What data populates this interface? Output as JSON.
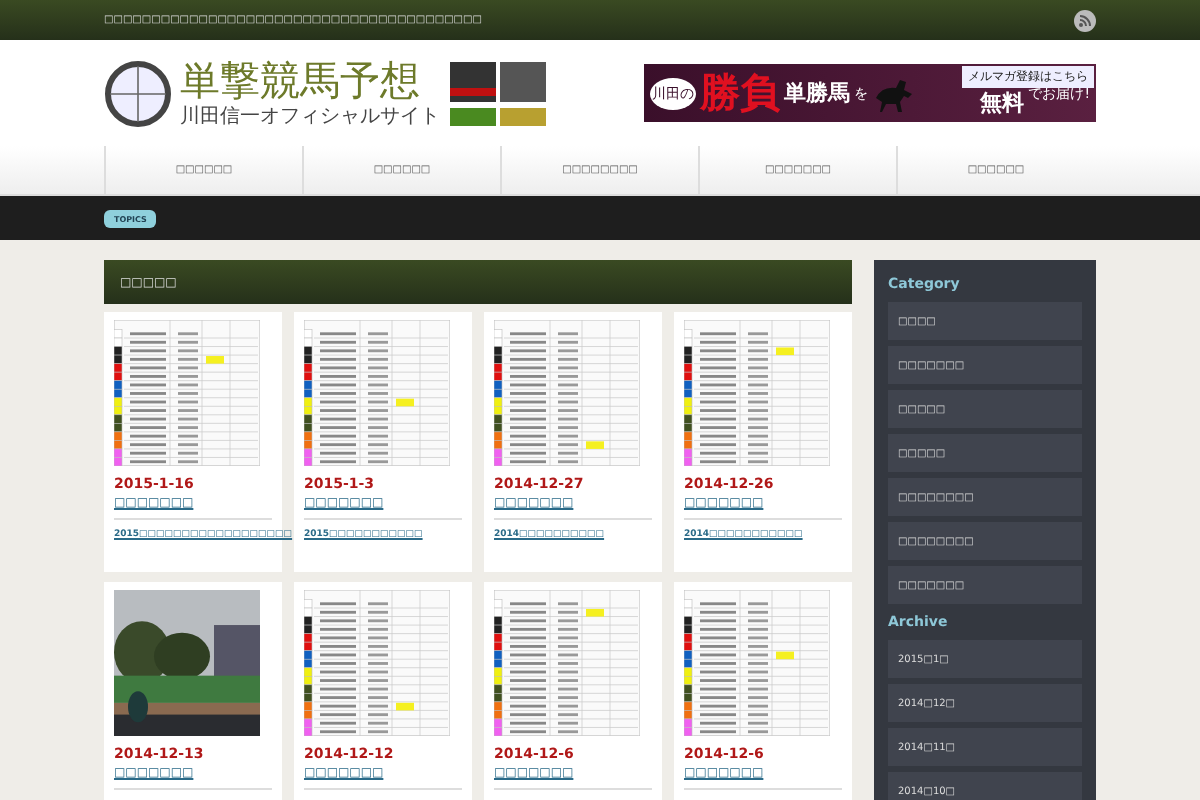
{
  "top_bar": {
    "text": "□□□□□□□□□□□□□□□□□□□□□□□□□□□□□□□□□□□□□□□□"
  },
  "logo": {
    "title": "単撃競馬予想",
    "subtitle": "川田信一オフィシャルサイト"
  },
  "banner": {
    "prefix": "川田の",
    "big": "勝負",
    "horse": "単勝馬",
    "particle": "を",
    "signup": "メルマガ登録はこちら",
    "free": "無料",
    "suffix": "でお届け!"
  },
  "nav": [
    {
      "label": "□□□□□□"
    },
    {
      "label": "□□□□□□"
    },
    {
      "label": "□□□□□□□□"
    },
    {
      "label": "□□□□□□□"
    },
    {
      "label": "□□□□□□"
    }
  ],
  "topics": {
    "badge": "TOPICS"
  },
  "section": {
    "title": "□□□□□"
  },
  "cards": [
    {
      "kind": "table",
      "date": "2015-1-16",
      "category": "□□□□□□□",
      "title": "2015□□□□□□□□□□□□□□□□□□"
    },
    {
      "kind": "table",
      "date": "2015-1-3",
      "category": "□□□□□□□",
      "title": "2015□□□□□□□□□□□"
    },
    {
      "kind": "table",
      "date": "2014-12-27",
      "category": "□□□□□□□",
      "title": "2014□□□□□□□□□□"
    },
    {
      "kind": "table",
      "date": "2014-12-26",
      "category": "□□□□□□□",
      "title": "2014□□□□□□□□□□□"
    },
    {
      "kind": "picture",
      "date": "2014-12-13",
      "category": "□□□□□□□"
    },
    {
      "kind": "table",
      "date": "2014-12-12",
      "category": "□□□□□□□"
    },
    {
      "kind": "table",
      "date": "2014-12-6",
      "category": "□□□□□□□"
    },
    {
      "kind": "table",
      "date": "2014-12-6",
      "category": "□□□□□□□"
    }
  ],
  "sidebar": {
    "category_heading": "Category",
    "categories": [
      "□□□□",
      "□□□□□□□",
      "□□□□□",
      "□□□□□",
      "□□□□□□□□",
      "□□□□□□□□",
      "□□□□□□□"
    ],
    "archive_heading": "Archive",
    "archives": [
      "2015□1□",
      "2014□12□",
      "2014□11□",
      "2014□10□"
    ]
  }
}
